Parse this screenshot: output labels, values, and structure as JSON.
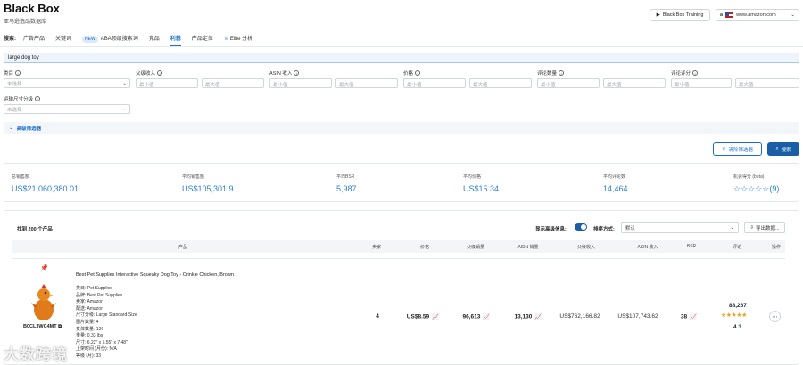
{
  "app": {
    "title": "Black Box",
    "subtitle": "亚马逊选品数据库"
  },
  "header": {
    "training_label": "Black Box Training",
    "site_label": "www.amazon.com",
    "site_flag": "US"
  },
  "nav": {
    "search_label": "搜索:",
    "tabs": [
      {
        "label": "广告产品",
        "active": false
      },
      {
        "label": "关键词",
        "active": false
      },
      {
        "badge": "NEW",
        "label": "ABA顶级搜索词",
        "active": false
      },
      {
        "label": "竞品",
        "active": false
      },
      {
        "label": "利基",
        "active": true
      },
      {
        "label": "产品定位",
        "active": false
      },
      {
        "label": "Elite 分析",
        "active": false
      }
    ]
  },
  "search": {
    "value": "large dog toy"
  },
  "filters": {
    "category": {
      "label": "类目",
      "placeholder": "未选择"
    },
    "parent_revenue": {
      "label": "父级收入",
      "min": "最小值",
      "max": "最大值"
    },
    "asin_revenue": {
      "label": "ASIN 收入",
      "min": "最小值",
      "max": "最大值"
    },
    "price": {
      "label": "价格",
      "min": "最小值",
      "max": "最大值"
    },
    "review_count": {
      "label": "评论数量",
      "min": "最小值",
      "max": "最大值"
    },
    "review_rating": {
      "label": "评论评分",
      "min": "最小值",
      "max": "最大值"
    },
    "size_tier": {
      "label": "运输尺寸分级",
      "placeholder": "未选择"
    }
  },
  "advanced": {
    "label": "高级筛选器"
  },
  "actions": {
    "clear": "清除筛选器",
    "search": "搜索"
  },
  "stats": [
    {
      "label": "总销售额",
      "value": "US$21,060,380.01"
    },
    {
      "label": "平均销售额",
      "value": "US$105,301.9"
    },
    {
      "label": "平均BSR",
      "value": "5,987"
    },
    {
      "label": "平均价格",
      "value": "US$15.34"
    },
    {
      "label": "平均评论数",
      "value": "14,464"
    },
    {
      "label": "机会得分 (beta)",
      "value": "(9)",
      "stars": "☆☆☆☆☆"
    }
  ],
  "table": {
    "found": "找到 200 个产品",
    "show_advanced": "显示高级信息:",
    "show_advanced_on": true,
    "sort_label": "排序方式:",
    "sort_value": "默认",
    "export": "导出数据...",
    "columns": [
      "产品",
      "卖家",
      "价格",
      "父级销量",
      "ASIN 销量",
      "父级收入",
      "ASIN 收入",
      "BSR",
      "评论",
      "操作"
    ],
    "rows": [
      {
        "name": "Best Pet Supplies Interactive Squeaky Dog Toy - Crinkle Chicken, Brown",
        "asin": "B0CL3WC4MT",
        "attrs": [
          {
            "k": "类目:",
            "v": "Pet Supplies"
          },
          {
            "k": "品牌:",
            "v": "Best Pet Supplies"
          },
          {
            "k": "卖家:",
            "v": "Amazon"
          },
          {
            "k": "配送:",
            "v": "Amazon"
          },
          {
            "k": "尺寸分级:",
            "v": "Large Standard-Size"
          },
          {
            "k": "图片数量:",
            "v": "4"
          },
          {
            "k": "变体数量:",
            "v": "136"
          },
          {
            "k": "重量:",
            "v": "0.33 lbs"
          },
          {
            "k": "尺寸:",
            "v": "6.22\" x 5.55\" x 7.48\""
          },
          {
            "k": "上架时间 (月份):",
            "v": "N/A"
          },
          {
            "k": "等级 (月):",
            "v": "33"
          }
        ],
        "sellers": "4",
        "price": "US$8.59",
        "parent_sales": "96,613",
        "asin_sales": "13,130",
        "parent_revenue": "US$762,166.82",
        "asin_revenue": "US$107,743.62",
        "bsr": "38",
        "reviews": "88,267",
        "stars": "★★★★★",
        "rating": "4.3"
      }
    ]
  },
  "watermark": "大数跨境",
  "colors": {
    "accent": "#1a73c9",
    "primary_button": "#1a5ea8",
    "stat_value": "#2c7fd6",
    "star": "#e8a317"
  }
}
